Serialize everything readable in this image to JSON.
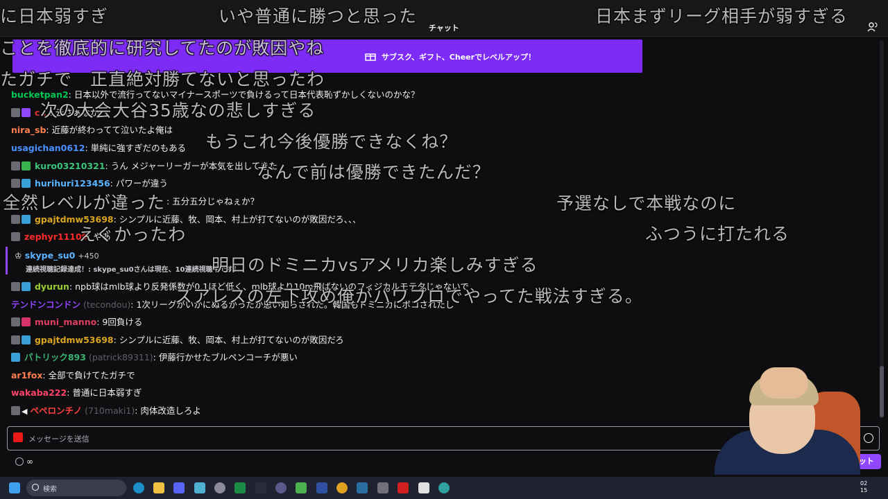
{
  "header": {
    "title": "チャット"
  },
  "banner": {
    "label": "サブスク、ギフト、Cheerでレベルアップ！"
  },
  "messages": [
    {
      "user": "bucketpan2",
      "color": "#00c853",
      "text": ": 日本以外で流行ってないマイナースポーツで負けるって日本代表恥ずかしくないのかな？",
      "badges": []
    },
    {
      "user": "c...",
      "color": "#e03030",
      "text": ": 云さぁなか",
      "badges": [
        "grey",
        "prime"
      ]
    },
    {
      "user": "nira_sb",
      "color": "#ff7f50",
      "text": ": 近藤が終わってて泣いたよ俺は",
      "badges": []
    },
    {
      "user": "usagichan0612",
      "color": "#4a90ff",
      "text": ": 単純に強すぎだのもある",
      "badges": []
    },
    {
      "user": "kuro03210321",
      "color": "#3cc47c",
      "text": ": うん メジャーリーガーが本気を出してきた",
      "badges": [
        "grey",
        "mod"
      ]
    },
    {
      "user": "hurihuri123456",
      "color": "#5ab4ff",
      "text": ": パワーが違う",
      "badges": [
        "grey",
        "sub"
      ]
    },
    {
      "user": "...",
      "color": "#b0b020",
      "text": ": 五分五分じゃねぇか？",
      "badges": []
    },
    {
      "user": "gpajtdmw53698",
      "color": "#daa520",
      "text": ": シンプルに近藤、牧、岡本、村上が打てないのが敗因だろ、、、",
      "badges": [
        "grey",
        "sub"
      ]
    },
    {
      "user": "zephyr11109",
      "color": "#ff2a2a",
      "text": ": やあ",
      "badges": [
        "grey"
      ]
    },
    {
      "user": "dyurun",
      "color": "#9acd32",
      "text": ": npb球はmlb球より反発係数が0.1ほど低く、mlb球より10m飛ばないのフィジカルモテタじゃないで",
      "badges": [
        "grey",
        "sub"
      ]
    },
    {
      "user": "テンドンコンドン",
      "login": "(tecondou)",
      "color": "#9146ff",
      "text": ": 1次リーグがいかにぬるかったか思い知らされた。韓国もドミニカにボコされたし",
      "badges": []
    },
    {
      "user": "muni_manno",
      "color": "#e03e5f",
      "text": ": 9回負ける",
      "badges": [
        "grey",
        "gift"
      ]
    },
    {
      "user": "gpajtdmw53698",
      "color": "#daa520",
      "text": ": シンプルに近藤、牧、岡本、村上が打てないのが敗因だろ",
      "badges": [
        "grey",
        "sub"
      ]
    },
    {
      "user": "パトリック893",
      "login": "(patrick89311)",
      "color": "#3cb371",
      "text": ": 伊藤行かせたブルペンコーチが悪い",
      "badges": [
        "sub"
      ]
    },
    {
      "user": "ar1fox",
      "color": "#ff7f50",
      "text": ": 全部で負けてたガチで",
      "badges": []
    },
    {
      "user": "wakaba222",
      "color": "#ff4466",
      "text": ": 普通に日本弱すぎ",
      "badges": []
    },
    {
      "user": "ペペロンチノ",
      "login": "(710maki1)",
      "color": "#ff4040",
      "text": ": 肉体改造しろよ",
      "badges": [
        "grey",
        "grey"
      ]
    }
  ],
  "sub_notice": {
    "user": "skype_su0",
    "points": "+450",
    "text": "連続視聴記録達成！: skype_su0さんは現在、10連続視聴中です！"
  },
  "input": {
    "placeholder": "メッセージを送信"
  },
  "points": {
    "value": "∞"
  },
  "chat_button": {
    "label": "チャット"
  },
  "overlay_comments": [
    "に日本弱すぎ",
    "いや普通に勝つと思った",
    "日本まずリーグ相手が弱すぎる",
    "ことを徹底的に研究してたのが敗因やね",
    "たガチで　正直絶対勝てないと思ったわ",
    "次の大会大谷35歳なの悲しすぎる",
    "もうこれ今後優勝できなくね？",
    "なんで前は優勝できたんだ？",
    "全然レベルが違った",
    "予選なしで本戦なのに",
    "ふつうに打たれる",
    "えぐかったわ",
    "明日のドミニカvsアメリカ楽しみすぎる",
    "スアレスの左下攻め俺がパワプロでやってた戦法すぎる。"
  ],
  "taskbar": {
    "search_label": "検索",
    "clock": "02\n15"
  },
  "colors": {
    "accent": "#9146ff",
    "banner": "#7d2cf5",
    "background": "#0e0e10"
  }
}
